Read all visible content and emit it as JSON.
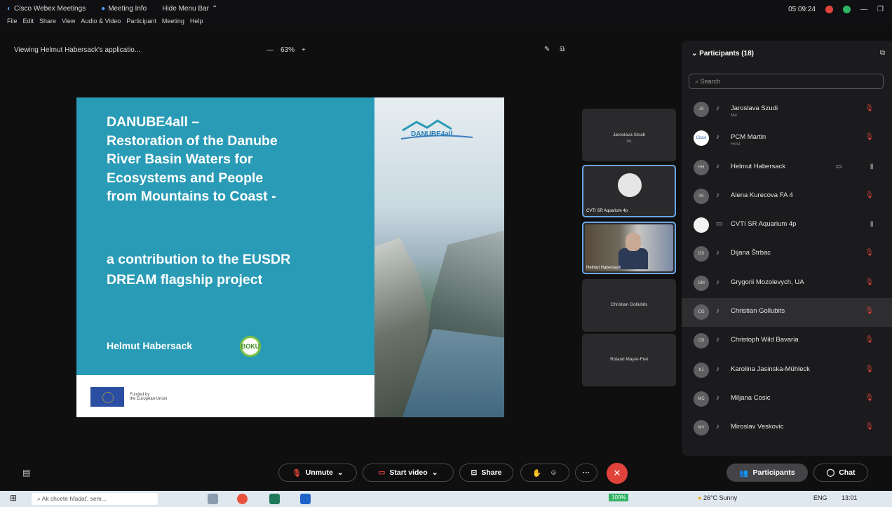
{
  "app": {
    "title": "Cisco Webex Meetings",
    "meeting_info": "Meeting Info",
    "hide_menu": "Hide Menu Bar",
    "time": "05:09:24"
  },
  "menu": [
    "File",
    "Edit",
    "Share",
    "View",
    "Audio & Video",
    "Participant",
    "Meeting",
    "Help"
  ],
  "viewbar": {
    "text": "Viewing Helmut Habersack's applicatio...",
    "zoom_minus": "—",
    "zoom": "63%",
    "zoom_plus": "+"
  },
  "slide": {
    "title_lines": [
      "DANUBE4all –",
      "Restoration of the Danube",
      "River Basin Waters for",
      "Ecosystems and People",
      "from Mountains to Coast -"
    ],
    "subtitle_lines": [
      "a contribution to the EUSDR",
      "DREAM flagship project"
    ],
    "author": "Helmut Habersack",
    "boku": "BOKU",
    "logo_text": "DANUBE4all",
    "funded": "Funded by",
    "funded2": "the European Union"
  },
  "tiles": [
    {
      "name": "Jaroslava Szudi",
      "sub": "Me"
    },
    {
      "name": "CVTI SR Aquarium 4p"
    },
    {
      "name": "Helmut Habersack"
    },
    {
      "name": "Christian Gollubits"
    },
    {
      "name": "Roland Mayer-Frei"
    }
  ],
  "panel": {
    "title": "Participants (18)",
    "search_placeholder": "Search",
    "participants": [
      {
        "initials": "JS",
        "name": "Jaroslava Szudi",
        "sub": "Me",
        "icon": "♪",
        "muted": true,
        "style": "gray"
      },
      {
        "initials": "Cisco",
        "name": "PCM Martin",
        "sub": "Host",
        "icon": "♪",
        "muted": true,
        "style": "blue"
      },
      {
        "initials": "HH",
        "name": "Helmut Habersack",
        "sub": "",
        "icon": "♪",
        "muted": false,
        "video": "▭",
        "style": "gray"
      },
      {
        "initials": "AK",
        "name": "Alena Kurecova FA 4",
        "sub": "",
        "icon": "♪",
        "muted": true,
        "style": "gray"
      },
      {
        "initials": "",
        "name": "CVTI SR Aquarium 4p",
        "sub": "",
        "icon": "▭",
        "muted": false,
        "style": "white"
      },
      {
        "initials": "DS",
        "name": "Dijana Štrbac",
        "sub": "",
        "icon": "♪",
        "muted": true,
        "style": "gray"
      },
      {
        "initials": "GM",
        "name": "Grygorii Mozolevych, UA",
        "sub": "",
        "icon": "♪",
        "muted": true,
        "style": "gray"
      },
      {
        "initials": "CG",
        "name": "Christian Gollubits",
        "sub": "",
        "icon": "♪",
        "muted": true,
        "style": "gray",
        "highlight": true
      },
      {
        "initials": "CB",
        "name": "Christoph Wild Bavaria",
        "sub": "",
        "icon": "♪",
        "muted": true,
        "style": "gray"
      },
      {
        "initials": "KJ",
        "name": "Karolina Jasinska-Mühleck",
        "sub": "",
        "icon": "♪",
        "muted": true,
        "style": "gray"
      },
      {
        "initials": "MC",
        "name": "Miljana Cosic",
        "sub": "",
        "icon": "♪",
        "muted": true,
        "style": "gray"
      },
      {
        "initials": "MV",
        "name": "Miroslav Veskovic",
        "sub": "",
        "icon": "♪",
        "muted": true,
        "style": "gray"
      }
    ]
  },
  "controls": {
    "unmute": "Unmute",
    "start_video": "Start video",
    "share": "Share",
    "participants": "Participants",
    "chat": "Chat"
  },
  "taskbar": {
    "search": "Ak chcete hľadať, sem...",
    "battery": "100%",
    "weather": "26°C Sunny",
    "lang": "ENG",
    "clock": "13:01"
  }
}
